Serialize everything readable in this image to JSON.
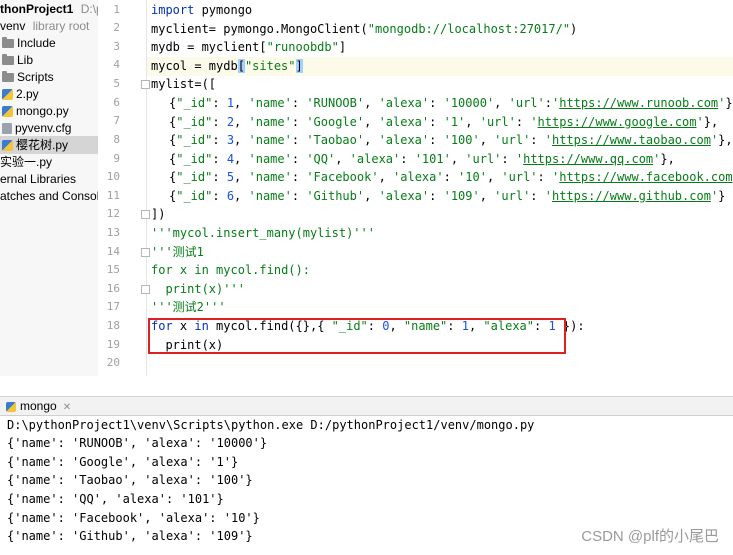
{
  "project_tree": {
    "root_label": "thonProject1",
    "root_path": "D:\\py",
    "venv_label": "venv",
    "venv_note": "library root",
    "items": [
      {
        "label": "Include",
        "type": "folder"
      },
      {
        "label": "Lib",
        "type": "folder"
      },
      {
        "label": "Scripts",
        "type": "folder"
      },
      {
        "label": "2.py",
        "type": "py"
      },
      {
        "label": "mongo.py",
        "type": "py"
      },
      {
        "label": "pyvenv.cfg",
        "type": "cfg"
      },
      {
        "label": "樱花树.py",
        "type": "py",
        "selected": true
      }
    ],
    "after_items": [
      "实验一.py",
      "ernal Libraries",
      "atches and Console"
    ]
  },
  "editor": {
    "line_numbers": [
      "1",
      "2",
      "3",
      "4",
      "5",
      "6",
      "7",
      "8",
      "9",
      "10",
      "11",
      "12",
      "13",
      "14",
      "15",
      "16",
      "17",
      "18",
      "19",
      "20"
    ],
    "code": {
      "l1_kw": "import",
      "l1_rest": " pymongo",
      "l2_a": "myclient= pymongo.MongoClient(",
      "l2_str": "\"mongodb://localhost:27017/\"",
      "l2_b": ")",
      "l3_a": "mydb = myclient[",
      "l3_str": "\"runoobdb\"",
      "l3_b": "]",
      "l4_a": "mycol = mydb",
      "l4_br1": "[",
      "l4_str": "\"sites\"",
      "l4_br2": "]",
      "l5": "mylist=([",
      "rows": [
        {
          "id": "1",
          "name": "'RUNOOB'",
          "alexa": "'10000'",
          "url": "https://www.runoob.com",
          "end": "},"
        },
        {
          "id": "2",
          "name": "'Google'",
          "alexa": "'1'",
          "url": "https://www.google.com",
          "end": "},"
        },
        {
          "id": "3",
          "name": "'Taobao'",
          "alexa": "'100'",
          "url": "https://www.taobao.com",
          "end": "},"
        },
        {
          "id": "4",
          "name": "'QQ'",
          "alexa": "'101'",
          "url": "https://www.qq.com",
          "end": "},"
        },
        {
          "id": "5",
          "name": "'Facebook'",
          "alexa": "'10'",
          "url": "https://www.facebook.com",
          "end": "},"
        },
        {
          "id": "6",
          "name": "'Github'",
          "alexa": "'109'",
          "url": "https://www.github.com",
          "end": "}"
        }
      ],
      "row_prefix": "{",
      "k_id": "\"_id\"",
      "k_name": "'name'",
      "k_alexa": "'alexa'",
      "k_url": "'url'",
      "l12": "])",
      "l13": "'''mycol.insert_many(mylist)'''",
      "l14": "'''测试1",
      "l15_kw1": "for",
      "l15_a": " x ",
      "l15_kw2": "in",
      "l15_b": " mycol.find():",
      "l16": "  print(x)'''",
      "l17": "'''测试2'''",
      "l18_kw1": "for",
      "l18_a": " x ",
      "l18_kw2": "in",
      "l18_b": " mycol.find({},{ ",
      "l18_k1": "\"_id\"",
      "l18_c": ": ",
      "l18_n1": "0",
      "l18_d": ", ",
      "l18_k2": "\"name\"",
      "l18_e": ": ",
      "l18_n2": "1",
      "l18_f": ", ",
      "l18_k3": "\"alexa\"",
      "l18_g": ": ",
      "l18_n3": "1",
      "l18_h": " }):",
      "l19": "  print(x)"
    }
  },
  "run_panel": {
    "tab_label": "mongo",
    "command": "D:\\pythonProject1\\venv\\Scripts\\python.exe D:/pythonProject1/venv/mongo.py",
    "output": [
      "{'name': 'RUNOOB', 'alexa': '10000'}",
      "{'name': 'Google', 'alexa': '1'}",
      "{'name': 'Taobao', 'alexa': '100'}",
      "{'name': 'QQ', 'alexa': '101'}",
      "{'name': 'Facebook', 'alexa': '10'}",
      "{'name': 'Github', 'alexa': '109'}"
    ]
  },
  "watermark": "CSDN @plf的小尾巴",
  "colors": {
    "highlight_box": "#e02020",
    "keyword": "#0033b3",
    "string": "#067d17",
    "number": "#1750eb"
  }
}
